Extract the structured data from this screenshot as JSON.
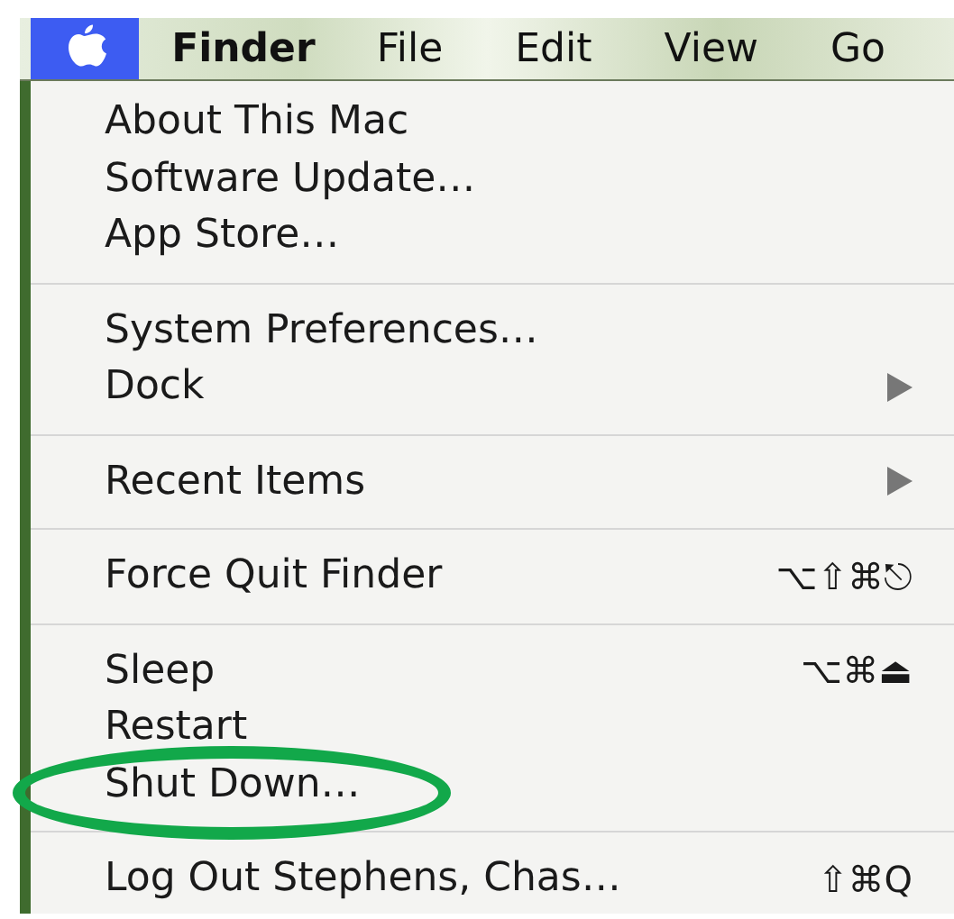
{
  "menu_bar": {
    "items": [
      {
        "kind": "apple",
        "selected": true
      },
      {
        "kind": "app",
        "label": "Finder",
        "selected": false
      },
      {
        "kind": "menu",
        "label": "File",
        "selected": false
      },
      {
        "kind": "menu",
        "label": "Edit",
        "selected": false
      },
      {
        "kind": "menu",
        "label": "View",
        "selected": false
      },
      {
        "kind": "menu",
        "label": "Go",
        "selected": false
      }
    ]
  },
  "menu": {
    "items": [
      {
        "kind": "item",
        "label": "About This Mac",
        "submenu": false,
        "circled": false
      },
      {
        "kind": "item",
        "label": "Software Update…",
        "submenu": false,
        "circled": false
      },
      {
        "kind": "item",
        "label": "App Store…",
        "submenu": false,
        "circled": false
      },
      {
        "kind": "separator"
      },
      {
        "kind": "item",
        "label": "System Preferences…",
        "submenu": false,
        "circled": false
      },
      {
        "kind": "item",
        "label": "Dock",
        "submenu": true,
        "circled": false
      },
      {
        "kind": "separator"
      },
      {
        "kind": "item",
        "label": "Recent Items",
        "submenu": true,
        "circled": false
      },
      {
        "kind": "separator"
      },
      {
        "kind": "item",
        "label": "Force Quit Finder",
        "shortcut": "⌥⇧⌘⎋",
        "submenu": false,
        "circled": false
      },
      {
        "kind": "separator"
      },
      {
        "kind": "item",
        "label": "Sleep",
        "shortcut": "⌥⌘⏏",
        "submenu": false,
        "circled": false
      },
      {
        "kind": "item",
        "label": "Restart",
        "submenu": false,
        "circled": false
      },
      {
        "kind": "item",
        "label": "Shut Down…",
        "submenu": false,
        "circled": true
      },
      {
        "kind": "separator"
      },
      {
        "kind": "item",
        "label": "Log Out Stephens, Chas…",
        "shortcut": "⇧⌘Q",
        "submenu": false,
        "circled": false
      }
    ]
  }
}
